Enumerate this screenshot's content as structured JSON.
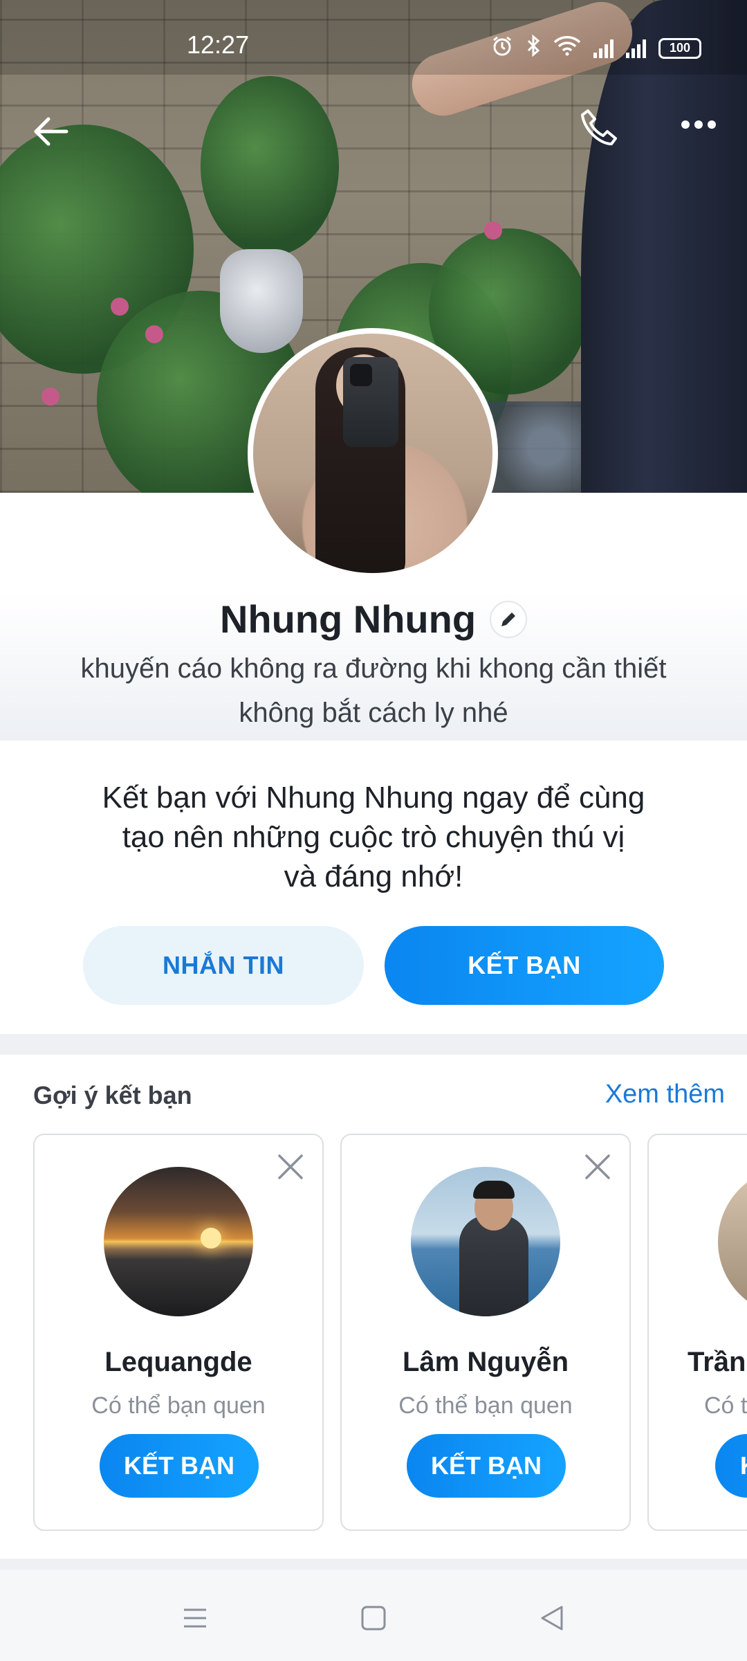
{
  "status_bar": {
    "time": "12:27",
    "battery": "100",
    "icons": [
      "alarm-icon",
      "bluetooth-icon",
      "wifi-icon",
      "signal-icon",
      "signal-icon",
      "battery-icon"
    ]
  },
  "header": {
    "back_icon": "arrow-left-icon",
    "call_icon": "phone-icon",
    "more_icon": "more-dots-icon"
  },
  "profile": {
    "name": "Nhung Nhung",
    "bio_line1": "khuyến  cáo không ra đường khi khong cần thiết",
    "bio_line2": "không bắt cách ly nhé"
  },
  "cta": {
    "line1": "Kết bạn với Nhung Nhung ngay để cùng",
    "line2": "tạo nên những cuộc trò chuyện thú vị",
    "line3": "và đáng nhớ!",
    "message_button": "NHẮN TIN",
    "add_friend_button": "KẾT BẠN"
  },
  "suggestions": {
    "title": "Gợi ý kết bạn",
    "see_more": "Xem thêm",
    "cards": [
      {
        "name": "Lequangde",
        "subtitle": "Có thể bạn quen",
        "button": "KẾT BẠN"
      },
      {
        "name": "Lâm Nguyễn",
        "subtitle": "Có thể bạn quen",
        "button": "KẾT BẠN"
      },
      {
        "name": "Trần",
        "subtitle": "Có t",
        "button": "K"
      }
    ]
  },
  "colors": {
    "accent": "#0a86f0",
    "link": "#1a79d6",
    "secondary_button_bg": "#e9f3fa"
  }
}
